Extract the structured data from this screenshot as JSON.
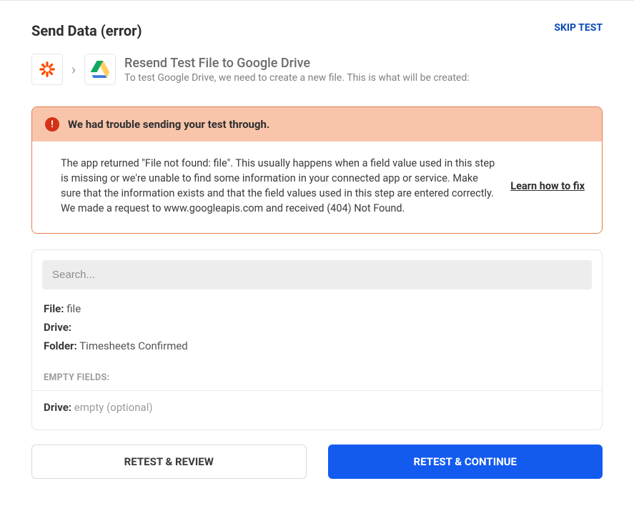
{
  "header": {
    "title": "Send Data (error)",
    "skip_label": "SKIP TEST"
  },
  "apps": {
    "title": "Resend Test File to Google Drive",
    "subtitle": "To test Google Drive, we need to create a new file. This is what will be created:"
  },
  "error": {
    "title": "We had trouble sending your test through.",
    "message": "The app returned \"File not found: file\". This usually happens when a field value used in this step is missing or we're unable to find some information in your connected app or service. Make sure that the information exists and that the field values used in this step are entered correctly. We made a request to www.googleapis.com and received (404) Not Found.",
    "learn_link": "Learn how to fix"
  },
  "search": {
    "placeholder": "Search..."
  },
  "fields": {
    "file_label": "File:",
    "file_value": "file",
    "drive_label": "Drive:",
    "drive_value": "",
    "folder_label": "Folder:",
    "folder_value": "Timesheets Confirmed"
  },
  "empty_fields": {
    "header": "EMPTY FIELDS:",
    "drive_label": "Drive:",
    "drive_value": "empty (optional)"
  },
  "buttons": {
    "retest_review": "RETEST & REVIEW",
    "retest_continue": "RETEST & CONTINUE"
  }
}
